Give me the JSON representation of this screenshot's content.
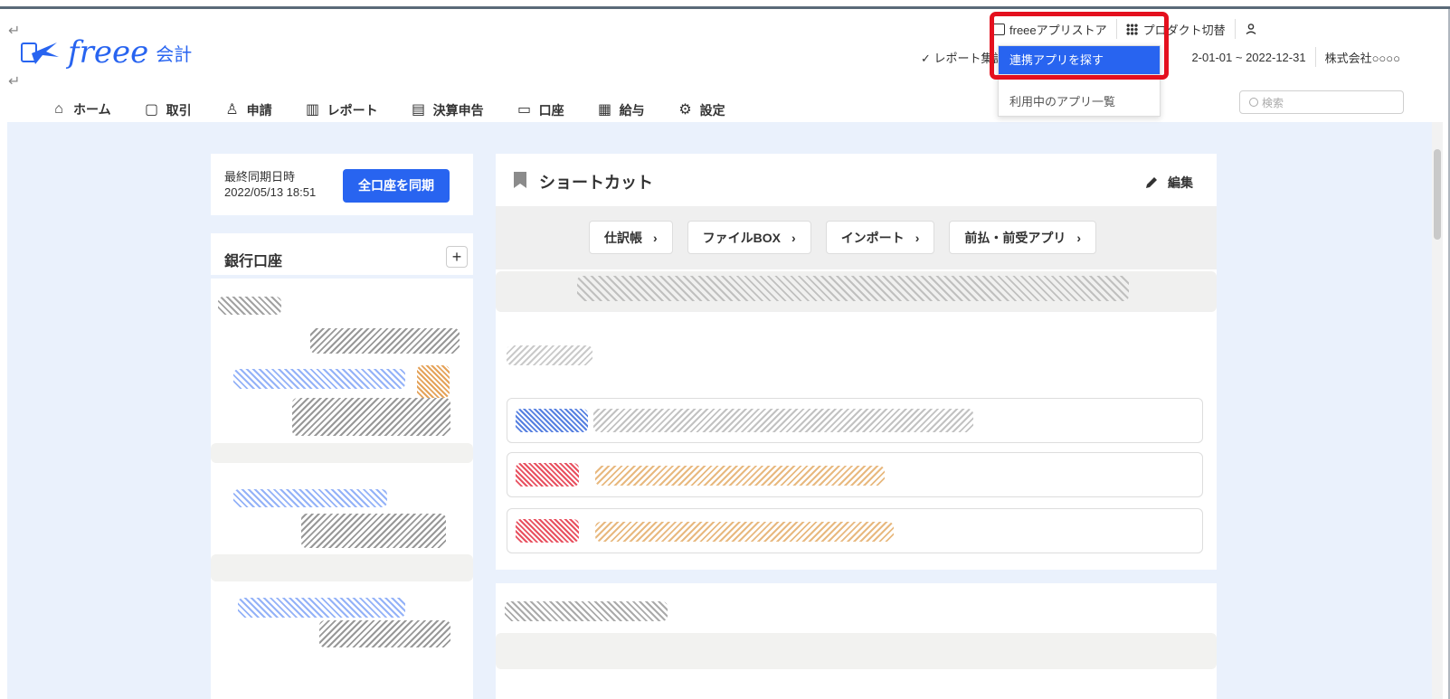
{
  "app": {
    "logo_text": "freee",
    "logo_sub": "会計"
  },
  "header": {
    "store_label": "freeeアプリストア",
    "product_switch_label": "プロダクト切替",
    "report_status": "✓ レポート集計完了",
    "period": "2-01-01 ~ 2022-12-31",
    "company": "株式会社○○○○"
  },
  "dropdown": {
    "items": [
      "連携アプリを探す",
      "利用中のアプリ一覧"
    ]
  },
  "nav": {
    "items": [
      {
        "label": "ホーム",
        "icon": "home-icon",
        "glyph": "⌂"
      },
      {
        "label": "取引",
        "icon": "tray-icon",
        "glyph": "▢"
      },
      {
        "label": "申請",
        "icon": "person-check-icon",
        "glyph": "♙"
      },
      {
        "label": "レポート",
        "icon": "bar-chart-icon",
        "glyph": "▥"
      },
      {
        "label": "決算申告",
        "icon": "document-list-icon",
        "glyph": "▤"
      },
      {
        "label": "口座",
        "icon": "card-icon",
        "glyph": "▭"
      },
      {
        "label": "給与",
        "icon": "payroll-icon",
        "glyph": "▦"
      },
      {
        "label": "設定",
        "icon": "gear-icon",
        "glyph": "⚙"
      }
    ]
  },
  "search": {
    "placeholder": "検索"
  },
  "sync": {
    "label": "最終同期日時",
    "time": "2022/05/13 18:51",
    "button": "全口座を同期"
  },
  "bank": {
    "title": "銀行口座",
    "add": "+"
  },
  "shortcut": {
    "title": "ショートカット",
    "edit": "編集",
    "chips": [
      "仕訳帳",
      "ファイルBOX",
      "インポート",
      "前払・前受アプリ"
    ]
  },
  "colors": {
    "accent": "#2864f0",
    "highlight_box": "#e4101e",
    "page_bg": "#eaf1fc"
  }
}
